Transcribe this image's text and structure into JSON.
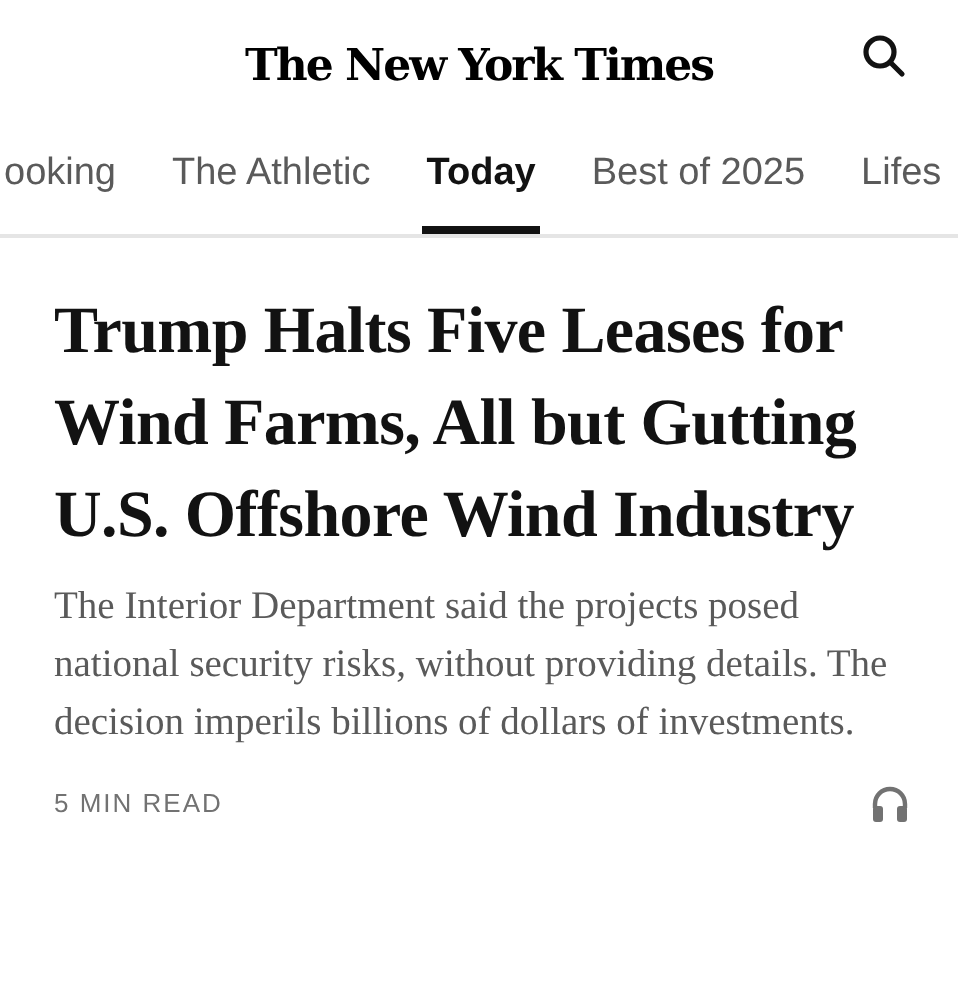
{
  "header": {
    "logo": "The New York Times"
  },
  "tabs": [
    {
      "label": "ooking",
      "selected": false
    },
    {
      "label": "The Athletic",
      "selected": false
    },
    {
      "label": "Today",
      "selected": true
    },
    {
      "label": "Best of 2025",
      "selected": false
    },
    {
      "label": "Lifes",
      "selected": false
    }
  ],
  "article": {
    "headline": "Trump Halts Five Leases for Wind Farms, All but Gutting U.S. Offshore Wind Industry",
    "summary": "The Interior Department said the projects posed national security risks, without providing details. The decision imperils billions of dollars of investments.",
    "read_time": "5 MIN READ"
  }
}
